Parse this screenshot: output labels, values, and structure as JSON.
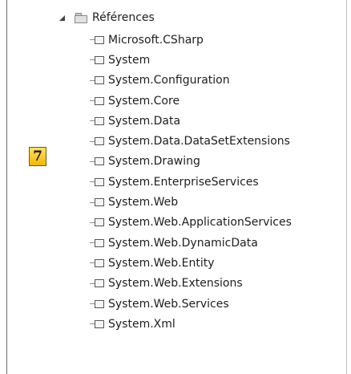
{
  "callout": {
    "number": "7"
  },
  "tree": {
    "root": {
      "label": "Références"
    },
    "children": [
      "Microsoft.CSharp",
      "System",
      "System.Configuration",
      "System.Core",
      "System.Data",
      "System.Data.DataSetExtensions",
      "System.Drawing",
      "System.EnterpriseServices",
      "System.Web",
      "System.Web.ApplicationServices",
      "System.Web.DynamicData",
      "System.Web.Entity",
      "System.Web.Extensions",
      "System.Web.Services",
      "System.Xml"
    ]
  }
}
